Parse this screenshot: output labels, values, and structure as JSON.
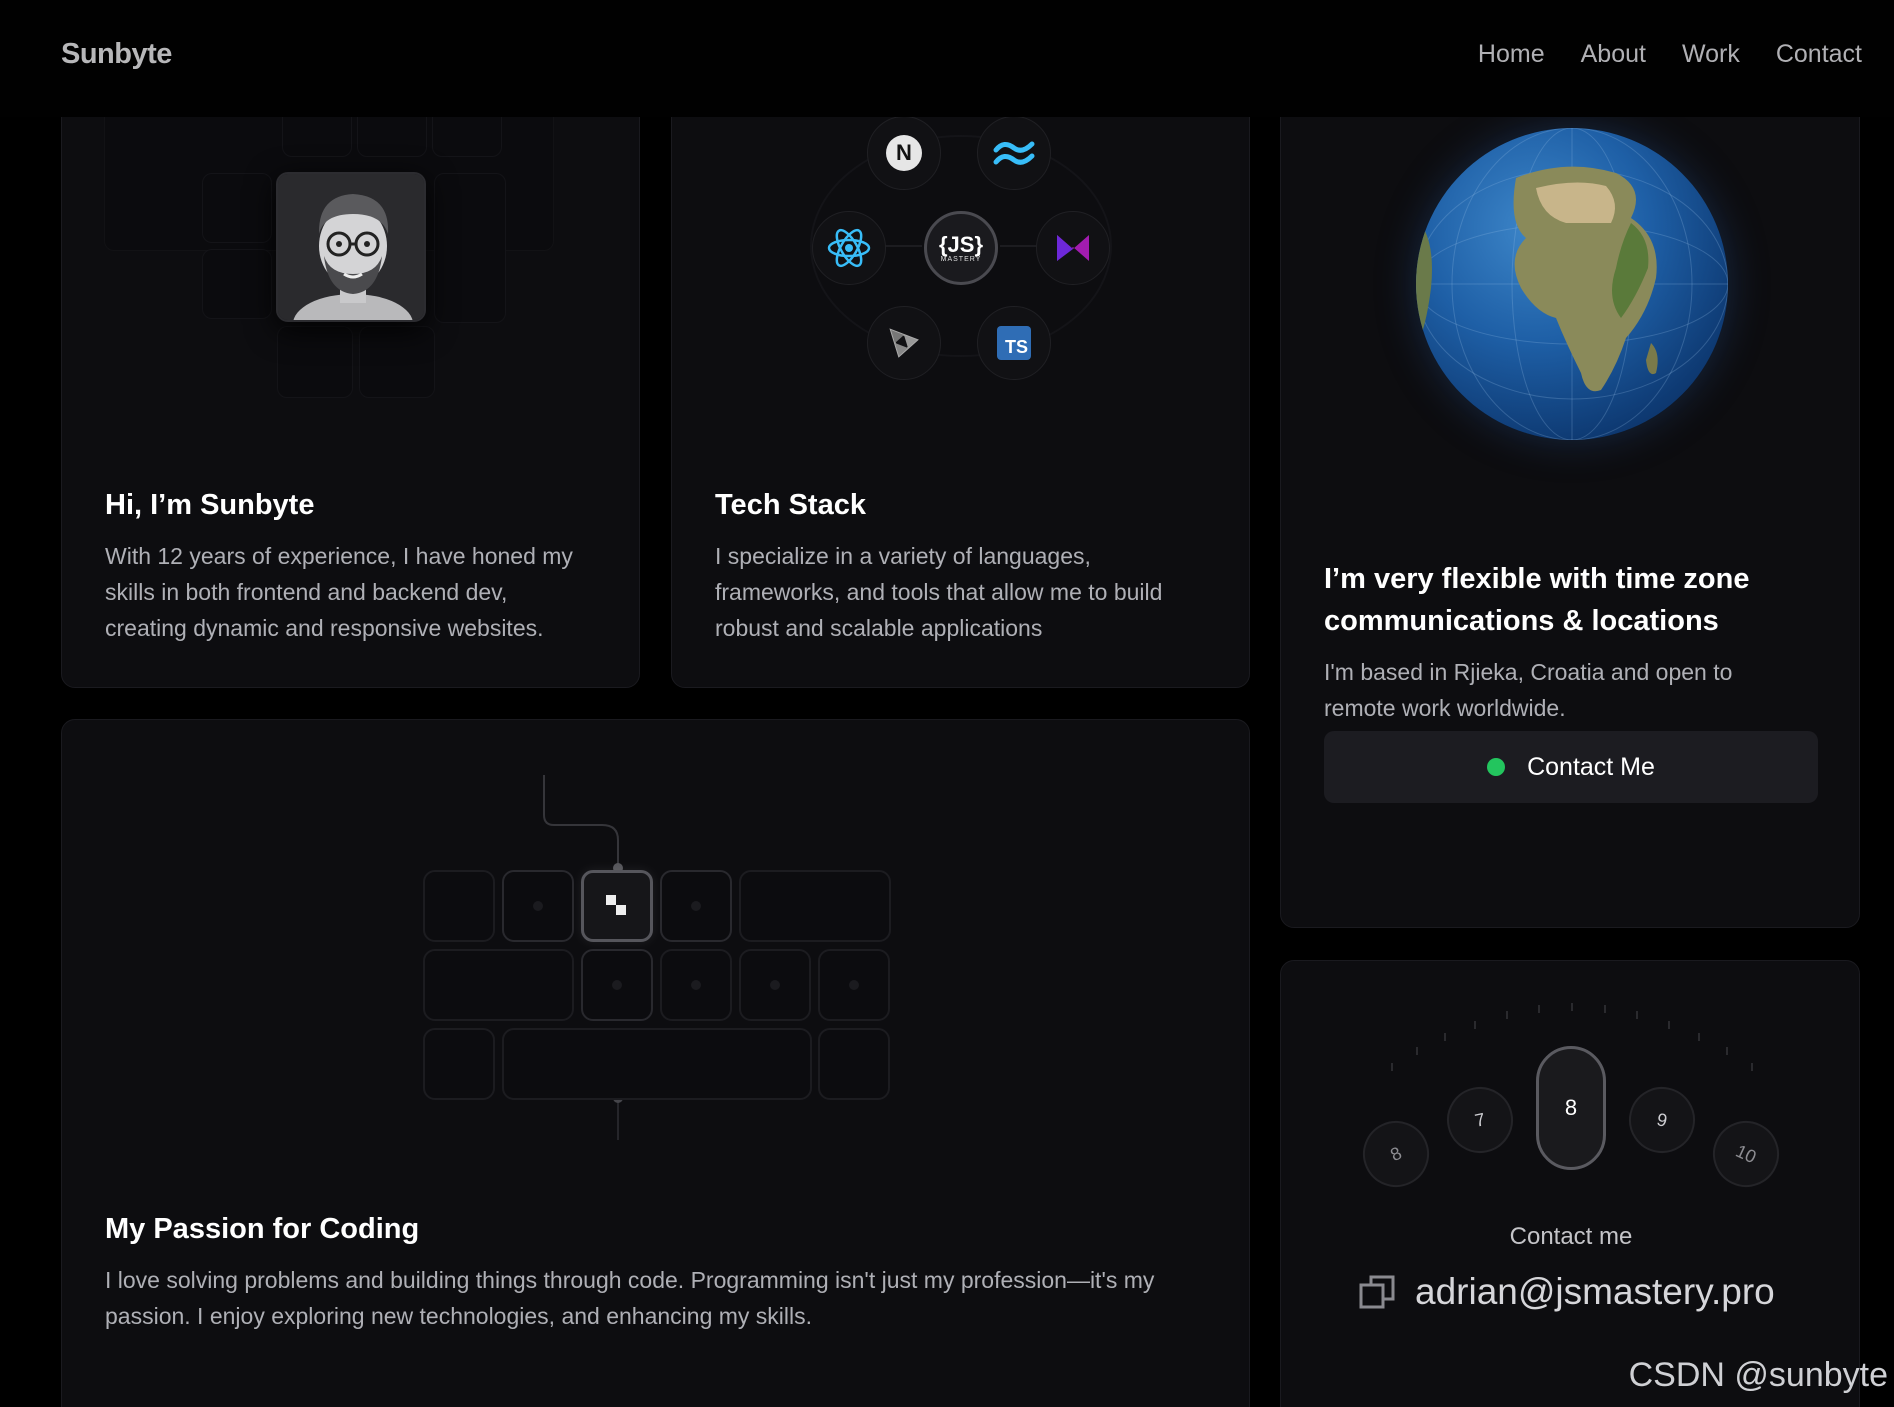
{
  "nav": {
    "brand": "Sunbyte",
    "links": [
      "Home",
      "About",
      "Work",
      "Contact"
    ]
  },
  "intro": {
    "title": "Hi, I’m Sunbyte",
    "body": "With 12 years of experience, I have honed my skills in both frontend and backend dev, creating dynamic and responsive websites."
  },
  "tech": {
    "title": "Tech Stack",
    "body": "I specialize in a variety of languages, frameworks, and tools that allow me to build robust and scalable applications",
    "icons": [
      "nextjs-icon",
      "tailwind-icon",
      "react-icon",
      "jsmastery-icon",
      "framer-icon",
      "threejs-icon",
      "typescript-icon"
    ],
    "center_label": "{JS}",
    "center_sublabel": "MASTERY",
    "ts_label": "TS",
    "next_label": "N"
  },
  "location": {
    "title": "I’m very flexible with time zone communications & locations",
    "body": "I'm based in Rjieka, Croatia and open to remote work worldwide.",
    "button_label": "Contact Me",
    "status_color": "#23c55e"
  },
  "passion": {
    "title": "My Passion for Coding",
    "body": "I love solving problems and building things through code. Programming isn't just my profession—it's my passion. I enjoy exploring new technologies, and enhancing my skills."
  },
  "contact": {
    "dial": [
      "8",
      "7",
      "8",
      "9",
      "10"
    ],
    "label": "Contact me",
    "email": "adrian@jsmastery.pro"
  },
  "watermark": "CSDN @sunbyte"
}
